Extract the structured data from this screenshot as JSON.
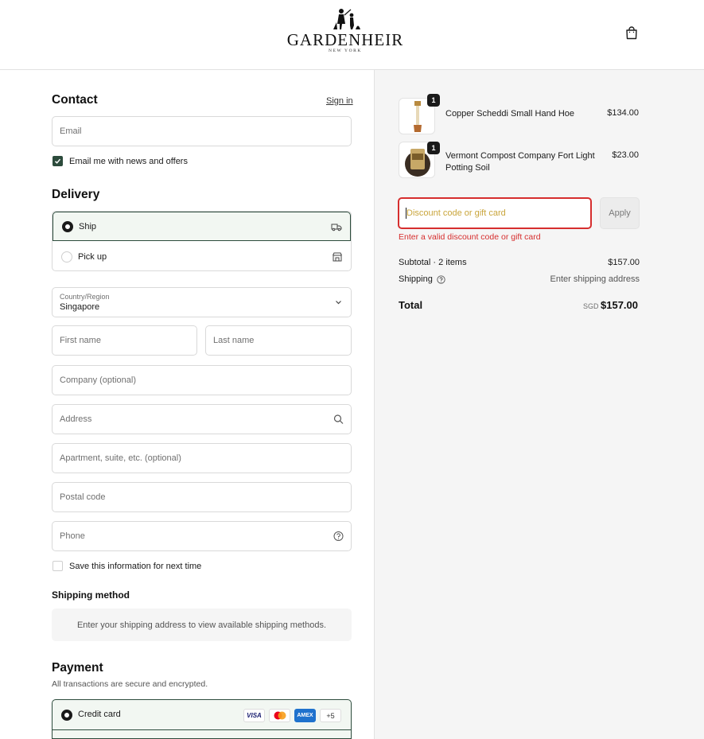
{
  "header": {
    "logo_word": "GARDENHEIR",
    "logo_sub": "NEW YORK"
  },
  "contact": {
    "title": "Contact",
    "sign_in": "Sign in",
    "email_placeholder": "Email",
    "newsletter_label": "Email me with news and offers",
    "newsletter_checked": true
  },
  "delivery": {
    "title": "Delivery",
    "options": [
      {
        "label": "Ship",
        "selected": true,
        "icon": "truck-icon"
      },
      {
        "label": "Pick up",
        "selected": false,
        "icon": "store-icon"
      }
    ],
    "country_label": "Country/Region",
    "country_value": "Singapore",
    "first_name": "First name",
    "last_name": "Last name",
    "company": "Company (optional)",
    "address": "Address",
    "apartment": "Apartment, suite, etc. (optional)",
    "postal": "Postal code",
    "phone": "Phone",
    "save_info": "Save this information for next time"
  },
  "shipping_method": {
    "title": "Shipping method",
    "message": "Enter your shipping address to view available shipping methods."
  },
  "payment": {
    "title": "Payment",
    "subtitle": "All transactions are secure and encrypted.",
    "method_label": "Credit card",
    "cards": [
      "VISA",
      "mastercard",
      "AMEX"
    ],
    "more_cards": "+5"
  },
  "summary": {
    "items": [
      {
        "name": "Copper Scheddi Small Hand Hoe",
        "price": "$134.00",
        "qty": "1"
      },
      {
        "name_line1": "Vermont Compost Company Fort Light",
        "name_line2": "Potting Soil",
        "price": "$23.00",
        "qty": "1"
      }
    ],
    "discount_placeholder": "Discount code or gift card",
    "apply_label": "Apply",
    "discount_error": "Enter a valid discount code or gift card",
    "subtotal_label": "Subtotal · 2 items",
    "subtotal_value": "$157.00",
    "shipping_label": "Shipping",
    "shipping_value": "Enter shipping address",
    "total_label": "Total",
    "currency": "SGD",
    "total_value": "$157.00"
  },
  "colors": {
    "accent": "#2c4b3c",
    "error": "#d62e2e",
    "panel_bg": "#f5f5f5"
  }
}
